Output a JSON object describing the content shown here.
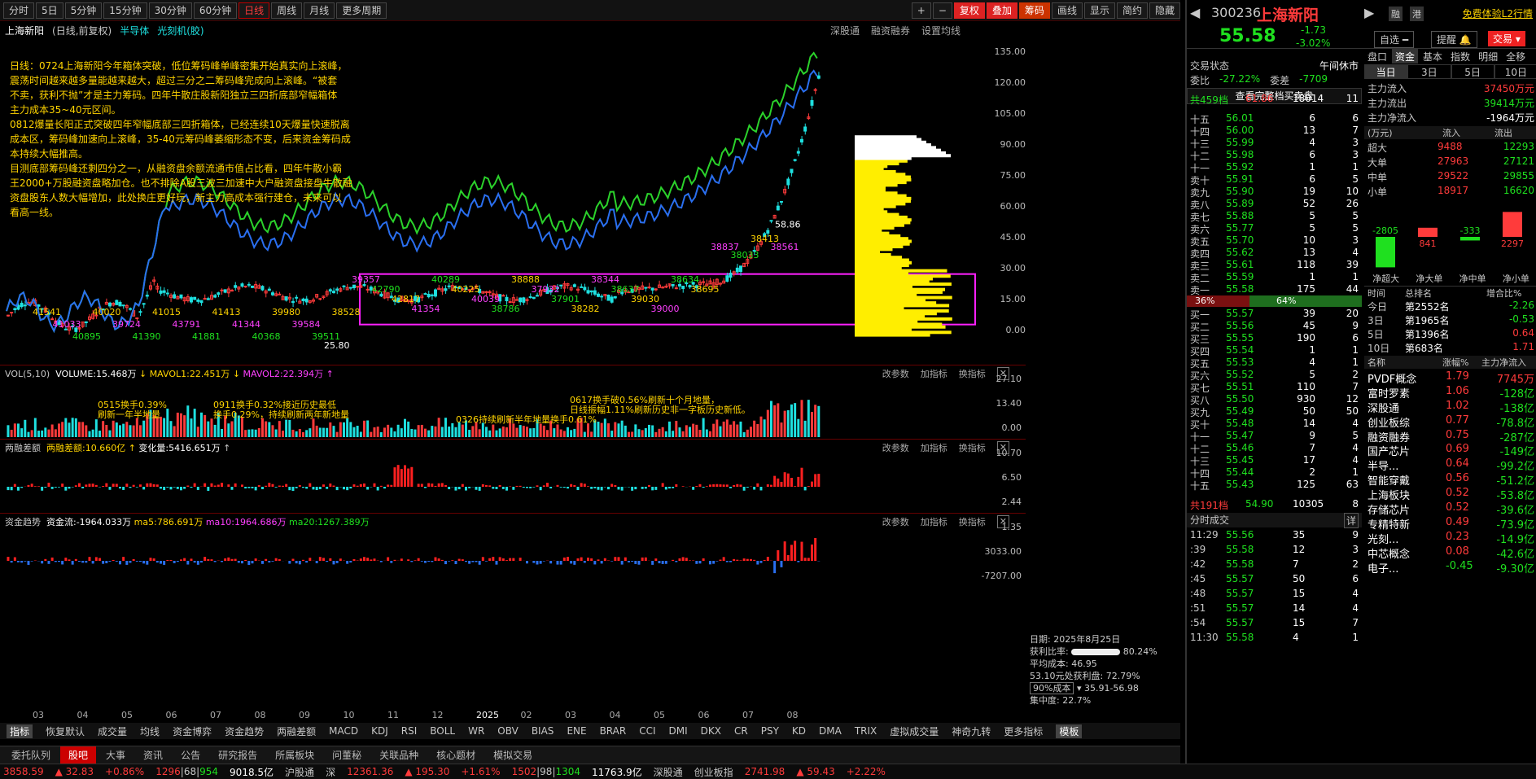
{
  "toolbar": {
    "periods": [
      "分时",
      "5日",
      "5分钟",
      "15分钟",
      "30分钟",
      "60分钟",
      "日线",
      "周线",
      "月线",
      "更多周期"
    ],
    "active": "日线",
    "icons_right": [
      "+",
      "−"
    ],
    "buttons": [
      "复权",
      "叠加",
      "筹码",
      "画线",
      "显示",
      "简约",
      "隐藏"
    ]
  },
  "chart_header": {
    "title": "上海新阳",
    "mode": "(日线,前复权)",
    "concept1": "半导体",
    "concept2": "光刻机(胶)",
    "links": [
      "深股通",
      "融资融券",
      "设置均线"
    ]
  },
  "annotation": [
    "日线：0724上海新阳今年箱体突破，低位筹码峰单峰密集开始真实向上滚峰，",
    "震荡时间越来越多量能越来越大，超过三分之二筹码峰完成向上滚峰。“被套",
    "不卖，获利不抛”才是主力筹码。四年牛散庄股新阳独立三四折底部窄幅箱体",
    "主力成本35~40元区间。",
    "0812爆量长阳正式突破四年窄幅底部三四折箱体，已经连续10天爆量快速脱离",
    "成本区，筹码峰加速向上滚峰，35-40元筹码峰萎缩形态不变，后来资金筹码成",
    "本持续大幅推高。",
    "目测底部筹码峰还剩四分之一，从融资盘余额流通市值占比看，四年牛散小霸",
    "王2000+万股融资盘略加仓。也不排除A股三波三加速中大户融资盘接盘牛散融",
    "资盘股东人数大幅增加，此处换庄更好玩，新主力高成本强行建仓，未来可以",
    "看高一线。"
  ],
  "main_axis": [
    "135.00",
    "120.00",
    "105.00",
    "90.00",
    "75.00",
    "60.00",
    "45.00",
    "30.00",
    "15.00",
    "0.00"
  ],
  "price_marks": {
    "high": "58.86",
    "low": "25.80"
  },
  "chart_labels": [
    "41541",
    "41033",
    "40895",
    "40020",
    "39724",
    "41390",
    "41015",
    "43791",
    "41881",
    "41413",
    "41344",
    "40368",
    "39980",
    "39584",
    "39511",
    "38528",
    "39357",
    "42790",
    "42817",
    "41354",
    "40289",
    "40225",
    "40039",
    "38786",
    "38888",
    "37932",
    "37901",
    "38282",
    "38344",
    "38637",
    "39030",
    "39000",
    "38634",
    "38695",
    "38837",
    "38033",
    "38413",
    "38561"
  ],
  "volume": {
    "title": "VOL(5,10)",
    "volume": "VOLUME:15.468万",
    "mavol1": "MAVOL1:22.451万",
    "mavol2": "MAVOL2:22.394万",
    "axis": [
      "27.10",
      "13.40",
      "0.00"
    ],
    "notes": [
      "0515换手0.39%",
      "刷新一年半地量",
      "0911换手0.32%接近历史最低",
      "换手0.29%，持续刷新两年新地量",
      "0326持续刷新半年地量换手0.61%",
      "0617换手破0.56%刷新十个月地量，",
      "日线振幅1.11%刷新历史非一字板历史新低。"
    ]
  },
  "margin": {
    "title": "两融差额",
    "value": "两融差额:10.660亿",
    "change": "变化量:5416.651万",
    "axis": [
      "10.70",
      "6.50",
      "2.44"
    ]
  },
  "fund": {
    "title": "资金趋势",
    "flow": "资金流:-1964.033万",
    "ma5": "ma5:786.691万",
    "ma10": "ma10:1964.686万",
    "ma20": "ma20:1267.389万",
    "axis": [
      "1.35",
      "3033.00",
      "-7207.00"
    ]
  },
  "sub_tools": [
    "改参数",
    "加指标",
    "换指标"
  ],
  "chip": {
    "date": "日期: 2025年8月25日",
    "profit_label": "获利比率:",
    "profit": "80.24%",
    "avg_label": "平均成本:",
    "avg": "46.95",
    "pos_label": "53.10元处获利盘:",
    "pos": "72.79%",
    "cost_sel": "90%成本",
    "cost_range": "35.91-56.98",
    "conc_label": "集中度:",
    "conc": "22.7%"
  },
  "xaxis": [
    "03",
    "04",
    "05",
    "06",
    "07",
    "08",
    "09",
    "10",
    "11",
    "12",
    "2025",
    "02",
    "03",
    "04",
    "05",
    "06",
    "07",
    "08"
  ],
  "indicators": [
    "指标",
    "恢复默认",
    "成交量",
    "均线",
    "资金博弈",
    "资金趋势",
    "两融差额",
    "MACD",
    "KDJ",
    "RSI",
    "BOLL",
    "WR",
    "OBV",
    "BIAS",
    "ENE",
    "BRAR",
    "CCI",
    "DMI",
    "DKX",
    "CR",
    "PSY",
    "KD",
    "DMA",
    "TRIX",
    "虚拟成交量",
    "神奇九转",
    "更多指标",
    "模板"
  ],
  "bottom_tabs": [
    "委托队列",
    "股吧",
    "大事",
    "资讯",
    "公告",
    "研究报告",
    "所属板块",
    "问董秘",
    "关联品种",
    "核心题材",
    "模拟交易"
  ],
  "bottom_active": "股吧",
  "status": {
    "idx1": "3858.59",
    "d1": "▲ 32.83",
    "p1": "+0.86%",
    "c1": "1296",
    "c2": "68",
    "c3": "954",
    "amt1": "9018.5亿",
    "hgt": "沪股通",
    "sz": "深",
    "idx2": "12361.36",
    "d2": "▲ 195.30",
    "p2": "+1.61%",
    "c4": "1502",
    "c5": "98",
    "c6": "1304",
    "amt2": "11763.9亿",
    "sgt": "深股通",
    "cyb": "创业板指",
    "idx3": "2741.98",
    "d3": "▲ 59.43",
    "p3": "+2.22%"
  },
  "stock": {
    "code": "300236",
    "name": "上海新阳",
    "tag1": "融",
    "tag2": "港",
    "trial": "免费体验L2行情",
    "price": "55.58",
    "change": "-1.73",
    "pct": "-3.02%",
    "self_select": "自选",
    "remind": "提醒",
    "trade": "交易"
  },
  "trade_state": {
    "label": "交易状态",
    "value": "午间休市",
    "wb_label": "委比",
    "wb": "-27.22%",
    "wc_label": "委差",
    "wc": "-7709",
    "view_all": "查看完整档买卖盘"
  },
  "sell_total": {
    "label": "共459档",
    "price": "61.86",
    "vol": "18014",
    "cnt": "11"
  },
  "sells": [
    [
      "十五",
      "56.01",
      "6",
      "6"
    ],
    [
      "十四",
      "56.00",
      "13",
      "7"
    ],
    [
      "十三",
      "55.99",
      "4",
      "3"
    ],
    [
      "十二",
      "55.98",
      "6",
      "3"
    ],
    [
      "十一",
      "55.92",
      "1",
      "1"
    ],
    [
      "卖十",
      "55.91",
      "6",
      "5"
    ],
    [
      "卖九",
      "55.90",
      "19",
      "10"
    ],
    [
      "卖八",
      "55.89",
      "52",
      "26"
    ],
    [
      "卖七",
      "55.88",
      "5",
      "5"
    ],
    [
      "卖六",
      "55.77",
      "5",
      "5"
    ],
    [
      "卖五",
      "55.70",
      "10",
      "3"
    ],
    [
      "卖四",
      "55.62",
      "13",
      "4"
    ],
    [
      "卖三",
      "55.61",
      "118",
      "39"
    ],
    [
      "卖二",
      "55.59",
      "1",
      "1"
    ],
    [
      "卖一",
      "55.58",
      "175",
      "44"
    ]
  ],
  "ratio": {
    "buy": "36%",
    "sell": "64%"
  },
  "buys": [
    [
      "买一",
      "55.57",
      "39",
      "20"
    ],
    [
      "买二",
      "55.56",
      "45",
      "9"
    ],
    [
      "买三",
      "55.55",
      "190",
      "6"
    ],
    [
      "买四",
      "55.54",
      "1",
      "1"
    ],
    [
      "买五",
      "55.53",
      "4",
      "1"
    ],
    [
      "买六",
      "55.52",
      "5",
      "2"
    ],
    [
      "买七",
      "55.51",
      "110",
      "7"
    ],
    [
      "买八",
      "55.50",
      "930",
      "12"
    ],
    [
      "买九",
      "55.49",
      "50",
      "50"
    ],
    [
      "买十",
      "55.48",
      "14",
      "4"
    ],
    [
      "十一",
      "55.47",
      "9",
      "5"
    ],
    [
      "十二",
      "55.46",
      "7",
      "4"
    ],
    [
      "十三",
      "55.45",
      "17",
      "4"
    ],
    [
      "十四",
      "55.44",
      "2",
      "1"
    ],
    [
      "十五",
      "55.43",
      "125",
      "63"
    ]
  ],
  "buy_total": {
    "label": "共191档",
    "price": "54.90",
    "vol": "10305",
    "cnt": "8"
  },
  "ticks_title": "分时成交",
  "ticks_more": "详",
  "ticks": [
    [
      "11:29",
      "55.56",
      "35",
      "9"
    ],
    [
      ":39",
      "55.58",
      "12",
      "3"
    ],
    [
      ":42",
      "55.58",
      "7",
      "2"
    ],
    [
      ":45",
      "55.57",
      "50",
      "6"
    ],
    [
      ":48",
      "55.57",
      "15",
      "4"
    ],
    [
      ":51",
      "55.57",
      "14",
      "4"
    ],
    [
      ":54",
      "55.57",
      "15",
      "7"
    ],
    [
      "11:30",
      "55.58",
      "4",
      "1"
    ]
  ],
  "fund_tabs": [
    "盘口",
    "资金",
    "基本",
    "指数",
    "明细",
    "全移"
  ],
  "fund_subtabs": [
    "当日",
    "3日",
    "5日",
    "10日"
  ],
  "main_flow": [
    [
      "主力流入",
      "37450万元"
    ],
    [
      "主力流出",
      "39414万元"
    ],
    [
      "主力净流入",
      "-1964万元"
    ]
  ],
  "flow_head": [
    "(万元)",
    "流入",
    "流出"
  ],
  "flow_rows": [
    [
      "超大",
      "9488",
      "12293"
    ],
    [
      "大单",
      "27963",
      "27121"
    ],
    [
      "中单",
      "29522",
      "29855"
    ],
    [
      "小单",
      "18917",
      "16620"
    ]
  ],
  "net_bars": {
    "values": [
      -2805,
      841,
      -333,
      2297
    ],
    "labels": [
      "净超大",
      "净大单",
      "净中单",
      "净小单"
    ]
  },
  "rank_head": [
    "时间",
    "总排名",
    "增合比%"
  ],
  "rank_rows": [
    [
      "今日",
      "第2552名",
      "-2.26"
    ],
    [
      "3日",
      "第1965名",
      "-0.53"
    ],
    [
      "5日",
      "第1396名",
      "0.64"
    ],
    [
      "10日",
      "第683名",
      "1.71"
    ]
  ],
  "concept_head": [
    "名称",
    "涨幅%",
    "主力净流入"
  ],
  "concepts": [
    [
      "PVDF概念",
      "1.79",
      "7745万"
    ],
    [
      "富时罗素",
      "1.06",
      "-128亿"
    ],
    [
      "深股通",
      "1.02",
      "-138亿"
    ],
    [
      "创业板综",
      "0.77",
      "-78.8亿"
    ],
    [
      "融资融券",
      "0.75",
      "-287亿"
    ],
    [
      "国产芯片",
      "0.69",
      "-149亿"
    ],
    [
      "半导...",
      "0.64",
      "-99.2亿"
    ],
    [
      "智能穿戴",
      "0.56",
      "-51.2亿"
    ],
    [
      "上海板块",
      "0.52",
      "-53.8亿"
    ],
    [
      "存储芯片",
      "0.52",
      "-39.6亿"
    ],
    [
      "专精特新",
      "0.49",
      "-73.9亿"
    ],
    [
      "光刻...",
      "0.23",
      "-14.9亿"
    ],
    [
      "中芯概念",
      "0.08",
      "-42.6亿"
    ],
    [
      "电子...",
      "-0.45",
      "-9.30亿"
    ]
  ]
}
